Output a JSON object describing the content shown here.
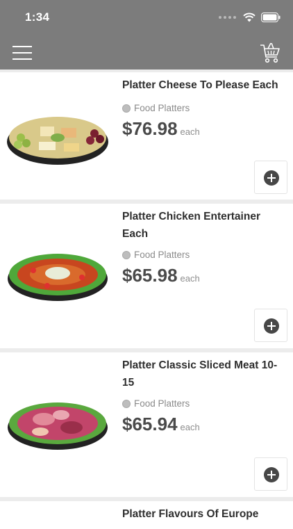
{
  "status_bar": {
    "time": "1:34"
  },
  "products": [
    {
      "title": "Platter Cheese To Please Each",
      "category": "Food Platters",
      "price": "$76.98",
      "unit": "each",
      "image": "cheese-platter"
    },
    {
      "title": "Platter Chicken Entertainer Each",
      "category": "Food Platters",
      "price": "$65.98",
      "unit": "each",
      "image": "chicken-platter"
    },
    {
      "title": "Platter Classic Sliced Meat 10-15",
      "category": "Food Platters",
      "price": "$65.94",
      "unit": "each",
      "image": "sliced-meat-platter"
    },
    {
      "title": "Platter Flavours Of Europe",
      "category": "",
      "price": "",
      "unit": "",
      "image": ""
    }
  ],
  "colors": {
    "header": "#7c7c7c",
    "price": "#4a4a4a",
    "title": "#2e2e2e",
    "divider": "#ececec"
  }
}
